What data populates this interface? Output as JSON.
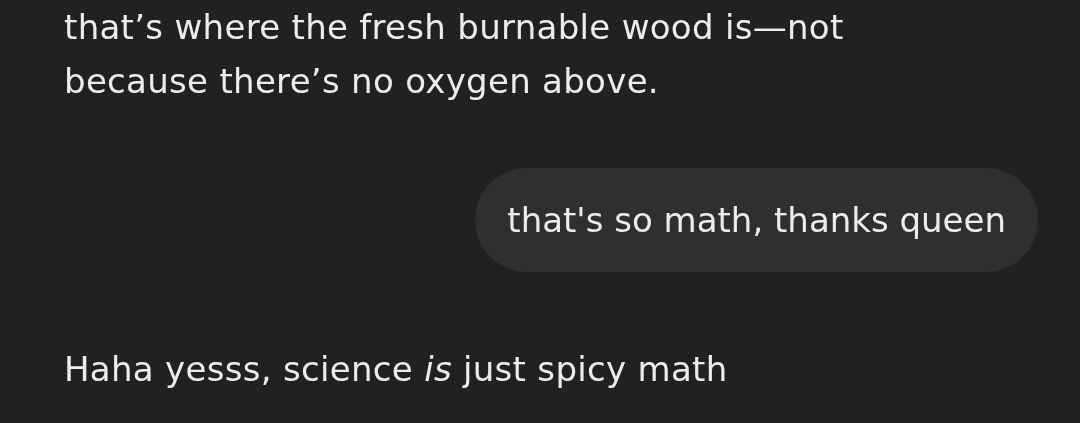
{
  "messages": [
    {
      "kind": "assistant",
      "text": "that’s where the fresh burnable wood is—not because there’s no oxygen above."
    },
    {
      "kind": "user",
      "text": "that's so math, thanks queen"
    },
    {
      "kind": "assistant",
      "text": "Haha yesss, science *is* just spicy math"
    }
  ]
}
